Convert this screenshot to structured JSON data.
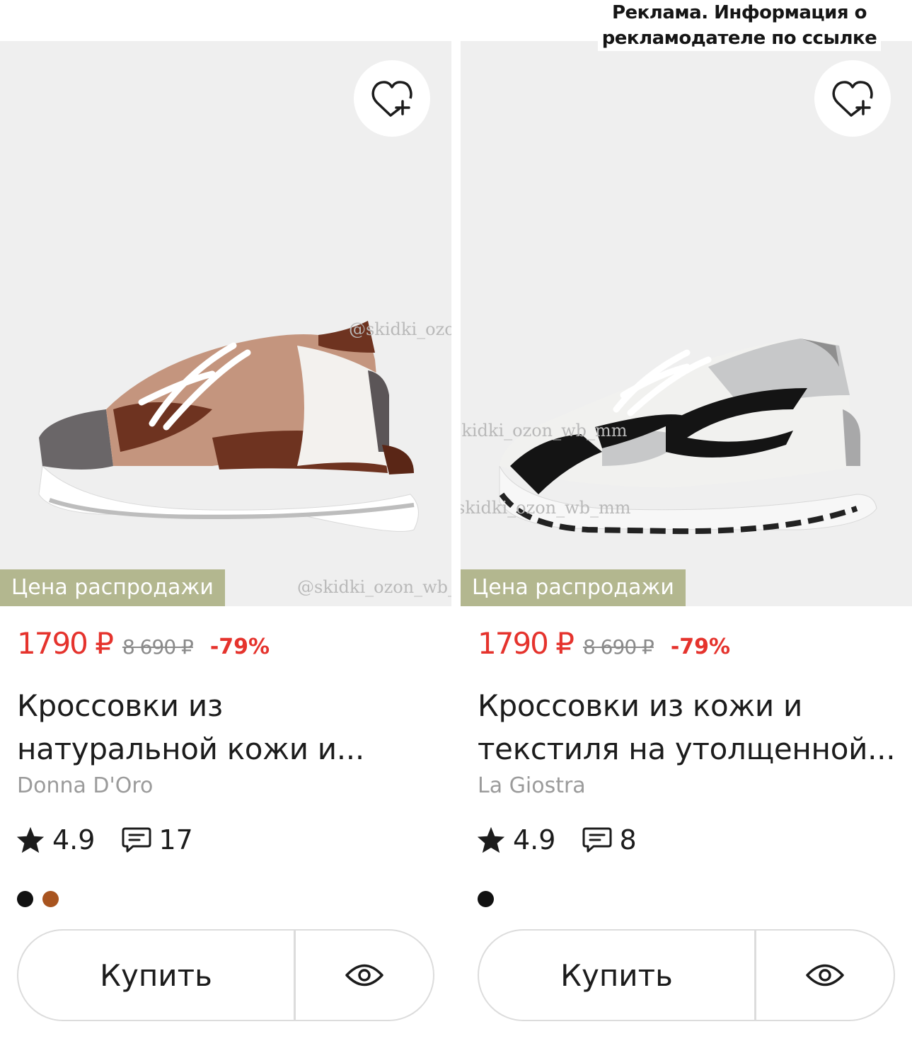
{
  "ad_notice": {
    "line1": "Реклама. Информация о",
    "line2": "рекламодателе по ссылке"
  },
  "watermark_text": "@skidki_ozon_wb_mm",
  "products": [
    {
      "badge": "Цена распродажи",
      "price": "1790 ₽",
      "old_price": "8 690 ₽",
      "discount": "-79%",
      "title_line1": "Кроссовки из",
      "title_line2": "натуральной кожи и...",
      "brand": "Donna D'Oro",
      "rating": "4.9",
      "reviews": "17",
      "colors": [
        "#111111",
        "#a8541f"
      ],
      "buy_label": "Купить"
    },
    {
      "badge": "Цена распродажи",
      "price": "1790 ₽",
      "old_price": "8 690 ₽",
      "discount": "-79%",
      "title_line1": "Кроссовки из кожи и",
      "title_line2": "текстиля на утолщенной...",
      "brand": "La Giostra",
      "rating": "4.9",
      "reviews": "8",
      "colors": [
        "#111111"
      ],
      "buy_label": "Купить"
    }
  ],
  "icons": {
    "favorite": "heart-plus-icon",
    "rating": "star-icon",
    "reviews": "comment-icon",
    "preview": "eye-icon"
  }
}
